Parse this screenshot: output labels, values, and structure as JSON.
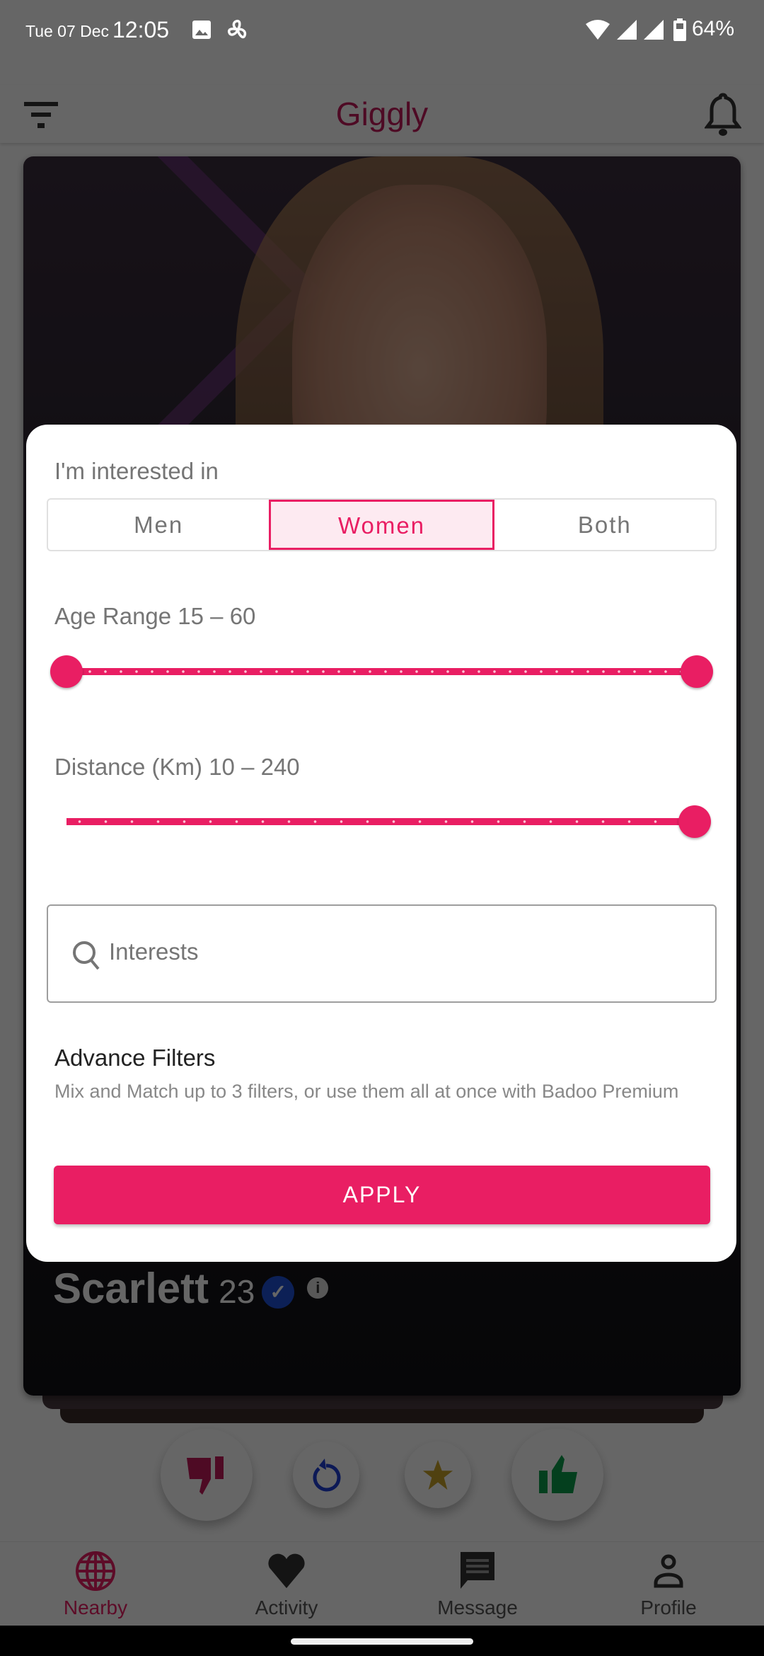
{
  "status_bar": {
    "date": "Tue 07 Dec",
    "time": "12:05",
    "battery": "64%",
    "icons": [
      "image-icon",
      "fan-icon",
      "wifi-icon",
      "signal-icon",
      "signal-icon",
      "battery-icon"
    ]
  },
  "app_bar": {
    "title": "Giggly",
    "left_icon": "filter-icon",
    "right_icon": "bell-icon"
  },
  "profile_card": {
    "name": "Scarlett",
    "age": "23",
    "verified": true,
    "info_icon": "info-icon"
  },
  "actions": [
    {
      "name": "dislike",
      "icon": "thumbs-down-icon",
      "color": "#c2185b"
    },
    {
      "name": "undo",
      "icon": "undo-icon",
      "color": "#1e3fd8"
    },
    {
      "name": "favorite",
      "icon": "star-icon",
      "color": "#c9a227"
    },
    {
      "name": "like",
      "icon": "thumbs-up-icon",
      "color": "#0a9e4a"
    }
  ],
  "bottom_nav": {
    "active": "Nearby",
    "items": [
      {
        "label": "Nearby",
        "icon": "globe-icon"
      },
      {
        "label": "Activity",
        "icon": "heart-icon"
      },
      {
        "label": "Message",
        "icon": "message-icon"
      },
      {
        "label": "Profile",
        "icon": "person-icon"
      }
    ]
  },
  "filter_dialog": {
    "interested_label": "I'm interested in",
    "options": [
      "Men",
      "Women",
      "Both"
    ],
    "selected_option": "Women",
    "age_range": {
      "label": "Age Range 15 – 60",
      "min": 15,
      "max": 60,
      "selected_low_fraction": 0,
      "selected_high_fraction": 1
    },
    "distance": {
      "label": "Distance (Km) 10 – 240",
      "min": 10,
      "max": 240,
      "selected_fraction": 1
    },
    "interests_placeholder": "Interests",
    "advance_title": "Advance Filters",
    "advance_desc": "Mix and Match up to 3 filters, or use them all at once with Badoo Premium",
    "apply_label": "APPLY"
  },
  "colors": {
    "accent": "#e91e63",
    "scrim": "rgba(0,0,0,0.6)"
  }
}
